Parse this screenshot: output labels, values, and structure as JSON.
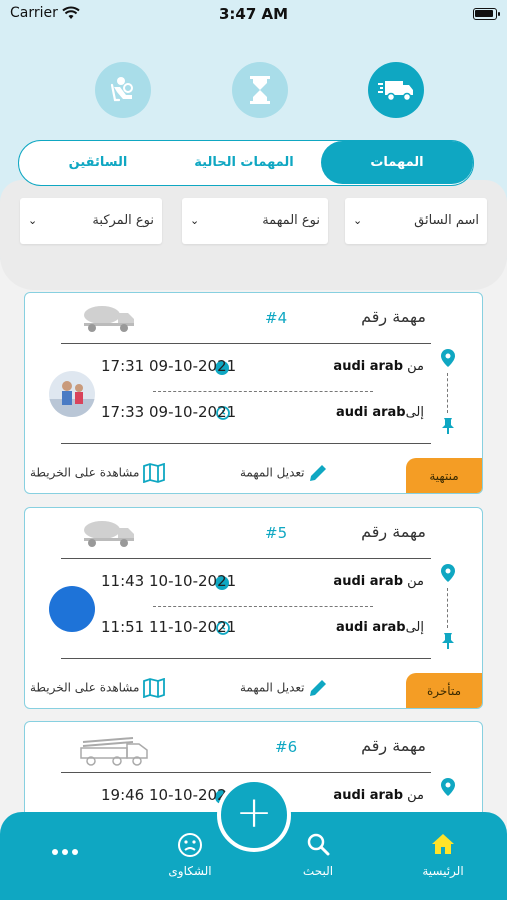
{
  "status_bar": {
    "carrier": "Carrier",
    "time": "3:47 AM"
  },
  "header": {
    "icons": [
      "driver-seat-icon",
      "hourglass-icon",
      "delivery-truck-icon"
    ],
    "tabs": {
      "tasks": "المهمات",
      "current_tasks": "المهمات الحالية",
      "drivers": "السائقين"
    },
    "filters": {
      "driver_name": "اسم السائق",
      "task_type": "نوع المهمة",
      "vehicle_type": "نوع المركبة"
    }
  },
  "tasks": [
    {
      "title": "مهمة رقم",
      "number": "#4",
      "from_label": "من",
      "from_value": "audi arab",
      "to_label": "إلى",
      "to_value": "audi arab",
      "start_time": "17:31 09-10-2021",
      "end_time": "17:33 09-10-2021",
      "edit_label": "تعديل المهمة",
      "map_label": "مشاهدة على الخريطة",
      "status": "منتهية",
      "status_color": "#f49d25"
    },
    {
      "title": "مهمة رقم",
      "number": "#5",
      "from_label": "من",
      "from_value": "audi arab",
      "to_label": "إلى",
      "to_value": "audi arab",
      "start_time": "11:43 10-10-2021",
      "end_time": "11:51 11-10-2021",
      "edit_label": "تعديل المهمة",
      "map_label": "مشاهدة على الخريطة",
      "status": "متأخرة",
      "status_color": "#f49d25"
    },
    {
      "title": "مهمة رقم",
      "number": "#6",
      "from_label": "من",
      "from_value": "audi arab",
      "start_time": "19:46 10-10-2021"
    }
  ],
  "bottom_nav": {
    "home": "الرئيسية",
    "search": "البحث",
    "complaints": "الشكاوى"
  },
  "colors": {
    "accent": "#0fa7c2",
    "accent_light": "#a9dde9",
    "header_bg": "#d7eef5",
    "badge": "#f49d25"
  }
}
